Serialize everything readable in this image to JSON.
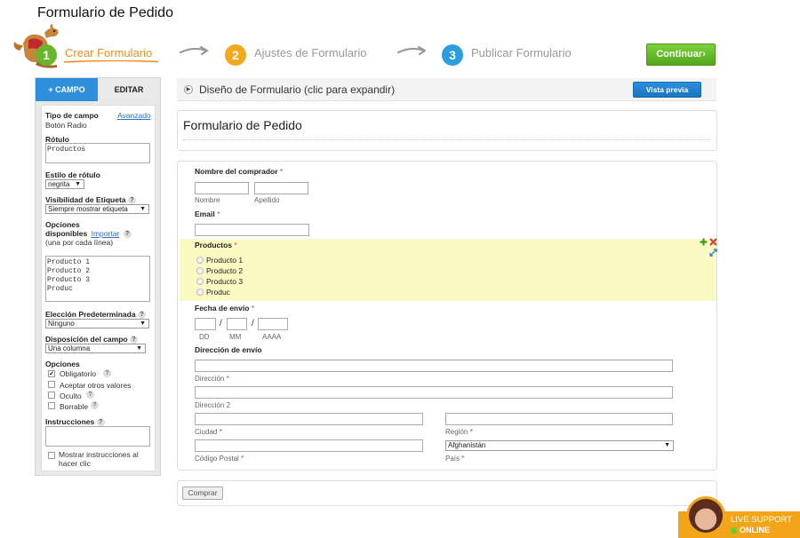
{
  "page": {
    "title": "Formulario de Pedido"
  },
  "steps": [
    {
      "number": "1",
      "label": "Crear Formulario"
    },
    {
      "number": "2",
      "label": "Ajustes de Formulario"
    },
    {
      "number": "3",
      "label": "Publicar Formulario"
    }
  ],
  "continue_label": "Continuar›",
  "left_panel": {
    "tab_field": "+ CAMPO",
    "tab_edit": "EDITAR",
    "field_type_label": "Tipo de campo",
    "field_type_value": "Botón Radio",
    "advanced_link": "Avanzado",
    "rotulo_label": "Rótulo",
    "rotulo_value": "Productos",
    "label_style_label": "Estilo de rótulo",
    "label_style_value": "negrita",
    "label_visibility_label": "Visibilidad de Etiqueta",
    "label_visibility_value": "Siempre mostrar etiqueta",
    "options_label_1": "Opciones",
    "options_label_2": "disponibles",
    "import_link": "Importar",
    "options_hint": "(una por cada línea)",
    "options_text": "Producto 1\nProducto 2\nProducto 3\nProduc",
    "default_choice_label": "Elección Predeterminada",
    "default_choice_value": "Ninguno",
    "layout_label": "Disposición del campo",
    "layout_value": "Una columna",
    "options_section_label": "Opciones",
    "checkboxes": [
      {
        "label": "Obligatorio",
        "checked": true,
        "help": true
      },
      {
        "label": "Aceptar otros valores",
        "checked": false,
        "help": false
      },
      {
        "label": "Oculto",
        "checked": false,
        "help": true
      },
      {
        "label": "Borrable",
        "checked": false,
        "help": true
      }
    ],
    "instructions_label": "Instrucciones",
    "show_instructions_1": "Mostrar instrucciones al",
    "show_instructions_2": "hacer clic",
    "help_glyph": "?"
  },
  "design_bar": {
    "label": "Diseño de Formulario (clic para expandir)",
    "preview_label": "Vista previa"
  },
  "form": {
    "title": "Formulario de Pedido",
    "buyer_label": "Nombre del comprador",
    "first_name_sub": "Nombre",
    "last_name_sub": "Apellido",
    "email_label": "Email",
    "products_label": "Productos",
    "products": [
      "Producto 1",
      "Producto 2",
      "Producto 3",
      "Produc"
    ],
    "date_label": "Fecha de envío",
    "date_sep": "/",
    "dd": "DD",
    "mm": "MM",
    "yyyy": "AAAA",
    "address_label": "Dirección de envío",
    "address_sub": "Dirección",
    "address2_sub": "Dirección 2",
    "city_sub": "Ciudad",
    "region_sub": "Región",
    "zip_sub": "Código Postal",
    "country_sub": "País",
    "country_value": "Afghanistán",
    "required_mark": "*",
    "submit_label": "Comprar"
  },
  "support": {
    "line1": "LIVE SUPPORT",
    "line2": "ONLINE"
  },
  "colors": {
    "accent_blue": "#2f8fdc",
    "continue_green": "#69b62d",
    "step1_orange": "#f08d1a",
    "highlight": "#fbfac2"
  }
}
